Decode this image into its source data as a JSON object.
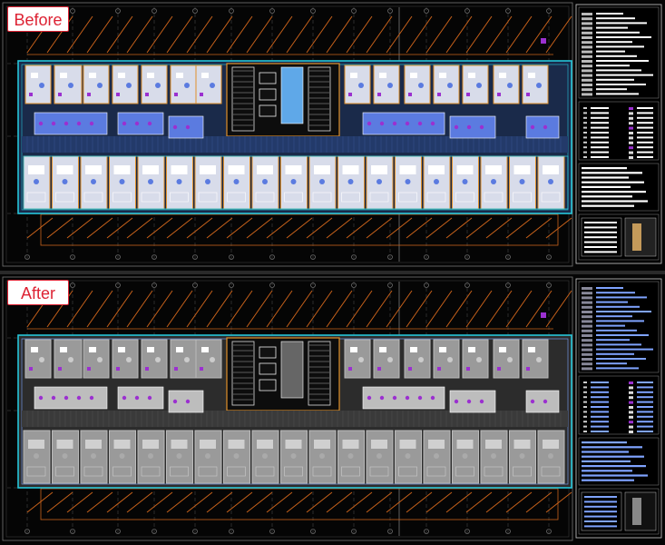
{
  "labels": {
    "before": "Before",
    "after": "After"
  },
  "colors": {
    "background": "#050505",
    "label_text": "#dd2233",
    "label_border": "#dd2233",
    "grid_orange": "#c8621b",
    "wall_orange": "#e0902a",
    "cyan": "#26c6da",
    "before_room": "#d8dcea",
    "before_blue": "#5b7be0",
    "after_room": "#9a9a9a",
    "after_blue": "#5b83e6",
    "purple": "#9b30d0",
    "legend_line": "#ffffff"
  },
  "icons": [
    "cad-floor-plan-drawing",
    "cad-title-block-legend"
  ]
}
